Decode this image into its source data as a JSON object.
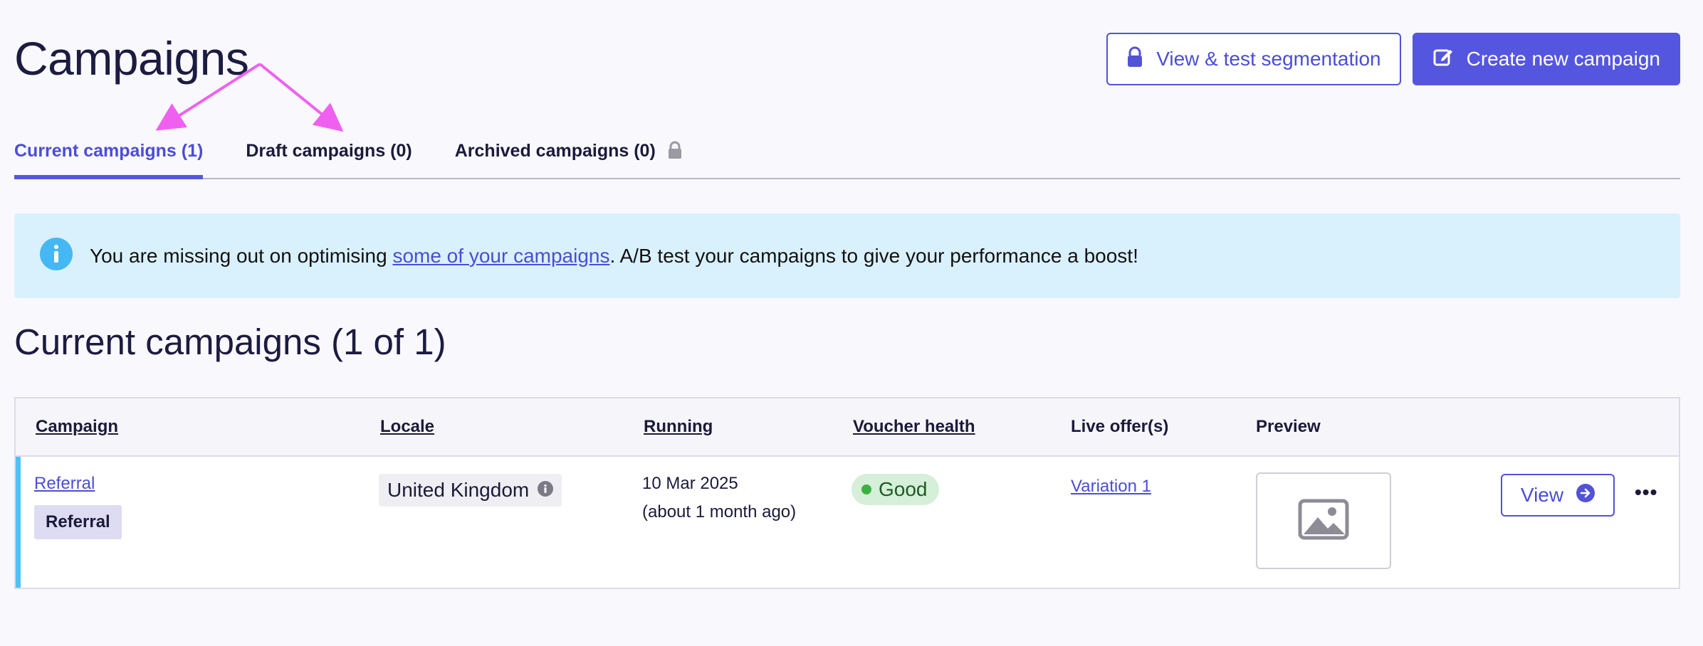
{
  "page": {
    "title": "Campaigns"
  },
  "header": {
    "segmentation_label": "View & test segmentation",
    "create_label": "Create new campaign"
  },
  "tabs": [
    {
      "label": "Current campaigns (1)",
      "active": true
    },
    {
      "label": "Draft campaigns (0)",
      "active": false
    },
    {
      "label": "Archived campaigns (0)",
      "active": false,
      "icon": "lock-icon"
    }
  ],
  "banner": {
    "icon": "info-icon",
    "text_before": "You are missing out on optimising ",
    "link_text": "some of your campaigns",
    "text_after": ". A/B test your campaigns to give your performance a boost!"
  },
  "section": {
    "title": "Current campaigns (1 of 1)"
  },
  "table": {
    "headers": {
      "campaign": "Campaign",
      "locale": "Locale",
      "running": "Running",
      "voucher_health": "Voucher health",
      "live_offers": "Live offer(s)",
      "preview": "Preview"
    },
    "rows": [
      {
        "campaign_link": "Referral",
        "campaign_tag": "Referral",
        "locale": "United Kingdom",
        "running_date": "10 Mar 2025",
        "running_relative": "(about 1 month ago)",
        "voucher_health": "Good",
        "live_offer": "Variation 1",
        "preview_icon": "image-placeholder-icon",
        "view_label": "View",
        "more_label": "•••"
      }
    ]
  },
  "colors": {
    "accent": "#5556e0",
    "banner_bg": "#d9f1fd",
    "health_good": "#3cb043",
    "row_accent": "#4ec2f7",
    "annotation_arrow": "#f060f0"
  }
}
